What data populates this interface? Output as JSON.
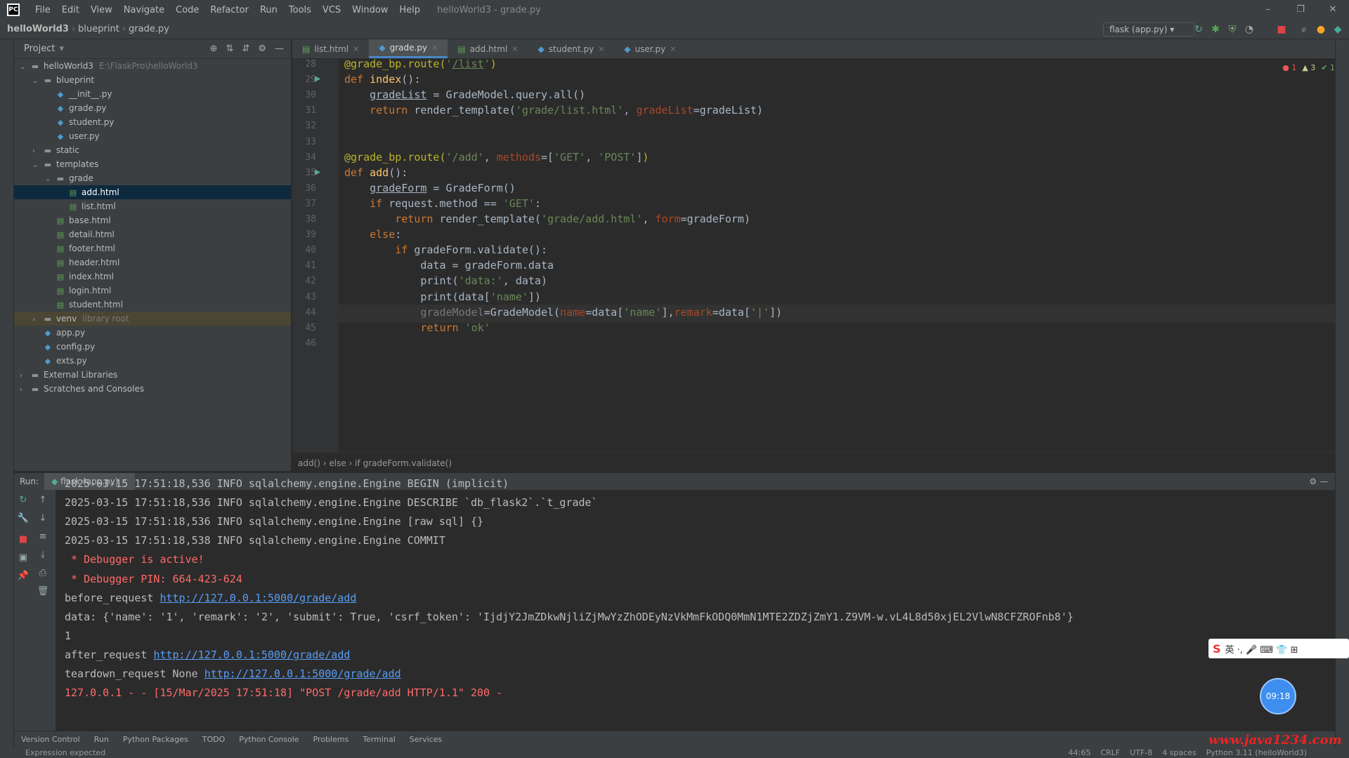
{
  "menubar": {
    "items": [
      "File",
      "Edit",
      "View",
      "Navigate",
      "Code",
      "Refactor",
      "Run",
      "Tools",
      "VCS",
      "Window",
      "Help"
    ],
    "title": "helloWorld3 - grade.py"
  },
  "navbar": {
    "crumbs": [
      "helloWorld3",
      "blueprint",
      "grade.py"
    ],
    "run_config": "flask (app.py)"
  },
  "project": {
    "header": "Project",
    "tree": [
      {
        "label": "helloWorld3",
        "extra": "E:\\FlaskPro\\helloWorld3",
        "depth": 0,
        "arrow": "v",
        "kind": "folder"
      },
      {
        "label": "blueprint",
        "depth": 1,
        "arrow": "v",
        "kind": "folder"
      },
      {
        "label": "__init__.py",
        "depth": 2,
        "kind": "py"
      },
      {
        "label": "grade.py",
        "depth": 2,
        "kind": "py"
      },
      {
        "label": "student.py",
        "depth": 2,
        "kind": "py"
      },
      {
        "label": "user.py",
        "depth": 2,
        "kind": "py"
      },
      {
        "label": "static",
        "depth": 1,
        "arrow": ">",
        "kind": "folder"
      },
      {
        "label": "templates",
        "depth": 1,
        "arrow": "v",
        "kind": "folder"
      },
      {
        "label": "grade",
        "depth": 2,
        "arrow": "v",
        "kind": "folder"
      },
      {
        "label": "add.html",
        "depth": 3,
        "kind": "html",
        "selected": true
      },
      {
        "label": "list.html",
        "depth": 3,
        "kind": "html"
      },
      {
        "label": "base.html",
        "depth": 2,
        "kind": "html"
      },
      {
        "label": "detail.html",
        "depth": 2,
        "kind": "html"
      },
      {
        "label": "footer.html",
        "depth": 2,
        "kind": "html"
      },
      {
        "label": "header.html",
        "depth": 2,
        "kind": "html"
      },
      {
        "label": "index.html",
        "depth": 2,
        "kind": "html"
      },
      {
        "label": "login.html",
        "depth": 2,
        "kind": "html"
      },
      {
        "label": "student.html",
        "depth": 2,
        "kind": "html"
      },
      {
        "label": "venv",
        "extra": "library root",
        "depth": 1,
        "arrow": ">",
        "kind": "folder",
        "highlight": true
      },
      {
        "label": "app.py",
        "depth": 1,
        "kind": "py"
      },
      {
        "label": "config.py",
        "depth": 1,
        "kind": "py"
      },
      {
        "label": "exts.py",
        "depth": 1,
        "kind": "py"
      },
      {
        "label": "External Libraries",
        "depth": 0,
        "arrow": ">",
        "kind": "folder"
      },
      {
        "label": "Scratches and Consoles",
        "depth": 0,
        "arrow": ">",
        "kind": "folder"
      }
    ]
  },
  "tabs": [
    {
      "label": "list.html",
      "kind": "html"
    },
    {
      "label": "grade.py",
      "kind": "py",
      "active": true
    },
    {
      "label": "add.html",
      "kind": "html"
    },
    {
      "label": "student.py",
      "kind": "py"
    },
    {
      "label": "user.py",
      "kind": "py"
    }
  ],
  "inspections": {
    "errors": "1",
    "warnings": "3",
    "ok": "1"
  },
  "editor": {
    "current_line": "44",
    "lines": [
      {
        "n": "28",
        "html": "<span class=\"dec\">@grade_bp.route(</span><span class=\"str\">'<span class=\"ul\">/list</span>'</span><span class=\"dec\">)</span>"
      },
      {
        "n": "29",
        "html": "<span class=\"kw\">def </span><span class=\"fn\">index</span>():"
      },
      {
        "n": "30",
        "html": "    <span class=\"ul\">gradeList</span> = GradeModel.query.all()"
      },
      {
        "n": "31",
        "html": "    <span class=\"kw\">return </span>render_template(<span class=\"str\">'grade/list.html'</span>, <span class=\"par\">gradeList</span>=gradeList)"
      },
      {
        "n": "32",
        "html": ""
      },
      {
        "n": "33",
        "html": ""
      },
      {
        "n": "34",
        "html": "<span class=\"dec\">@grade_bp.route(</span><span class=\"str\">'/add'</span>, <span class=\"par\">methods</span>=[<span class=\"str\">'GET'</span>, <span class=\"str\">'POST'</span>]<span class=\"dec\">)</span>"
      },
      {
        "n": "35",
        "html": "<span class=\"kw\">def </span><span class=\"fn\">add</span>():"
      },
      {
        "n": "36",
        "html": "    <span class=\"ul\">gradeForm</span> = GradeForm()"
      },
      {
        "n": "37",
        "html": "    <span class=\"kw\">if </span>request.method == <span class=\"str\">'GET'</span>:"
      },
      {
        "n": "38",
        "html": "        <span class=\"kw\">return </span>render_template(<span class=\"str\">'grade/add.html'</span>, <span class=\"par\">form</span>=gradeForm)"
      },
      {
        "n": "39",
        "html": "    <span class=\"kw\">else</span>:"
      },
      {
        "n": "40",
        "html": "        <span class=\"kw\">if </span>gradeForm.validate():"
      },
      {
        "n": "41",
        "html": "            data = gradeForm.data"
      },
      {
        "n": "42",
        "html": "            print(<span class=\"str\">'data:'</span>, data)"
      },
      {
        "n": "43",
        "html": "            print(data[<span class=\"str\">'name'</span>])"
      },
      {
        "n": "44",
        "html": "            <span style=\"color:#777\">gradeModel</span>=GradeModel(<span class=\"par\">name</span>=data[<span class=\"str\">'name'</span>],<span class=\"par\">remark</span>=data[<span class=\"str\">'|'</span>])"
      },
      {
        "n": "45",
        "html": "            <span class=\"kw\">return </span><span class=\"str\">'ok'</span>"
      },
      {
        "n": "46",
        "html": ""
      }
    ]
  },
  "breadcrumb_bottom": "add()  ›  else  ›  if gradeForm.validate()",
  "run": {
    "label": "Run:",
    "tab": "flask (app.py)",
    "console": [
      {
        "t": "2025-03-15 17:51:18,536 INFO sqlalchemy.engine.Engine BEGIN (implicit)",
        "c": ""
      },
      {
        "t": "2025-03-15 17:51:18,536 INFO sqlalchemy.engine.Engine DESCRIBE `db_flask2`.`t_grade`",
        "c": ""
      },
      {
        "t": "2025-03-15 17:51:18,536 INFO sqlalchemy.engine.Engine [raw sql] {}",
        "c": ""
      },
      {
        "t": "2025-03-15 17:51:18,538 INFO sqlalchemy.engine.Engine COMMIT",
        "c": ""
      },
      {
        "t": " * Debugger is active!",
        "c": "red"
      },
      {
        "t": " * Debugger PIN: 664-423-624",
        "c": "red"
      },
      {
        "t": "before_request ",
        "link": "http://127.0.0.1:5000/grade/add",
        "c": ""
      },
      {
        "t": "data: {'name': '1', 'remark': '2', 'submit': True, 'csrf_token': 'IjdjY2JmZDkwNjliZjMwYzZhODEyNzVkMmFkODQ0MmN1MTE2ZDZjZmY1.Z9VM-w.vL4L8d50xjEL2VlwN8CFZROFnb8'}",
        "c": ""
      },
      {
        "t": "1",
        "c": ""
      },
      {
        "t": "after_request ",
        "link": "http://127.0.0.1:5000/grade/add",
        "c": ""
      },
      {
        "t": "teardown_request None ",
        "link": "http://127.0.0.1:5000/grade/add",
        "c": ""
      },
      {
        "t": "127.0.0.1 - - [15/Mar/2025 17:51:18] \"POST /grade/add HTTP/1.1\" 200 -",
        "c": "red"
      }
    ]
  },
  "bottom_tabs": [
    "Version Control",
    "Run",
    "Python Packages",
    "TODO",
    "Python Console",
    "Problems",
    "Terminal",
    "Services"
  ],
  "status": {
    "left": "Expression expected",
    "position": "44:65",
    "line_sep": "CRLF",
    "encoding": "UTF-8",
    "indent": "4 spaces",
    "interpreter": "Python 3.11 (helloWorld3)"
  },
  "overlay": {
    "time": "09:18",
    "watermark": "www.java1234.com"
  }
}
